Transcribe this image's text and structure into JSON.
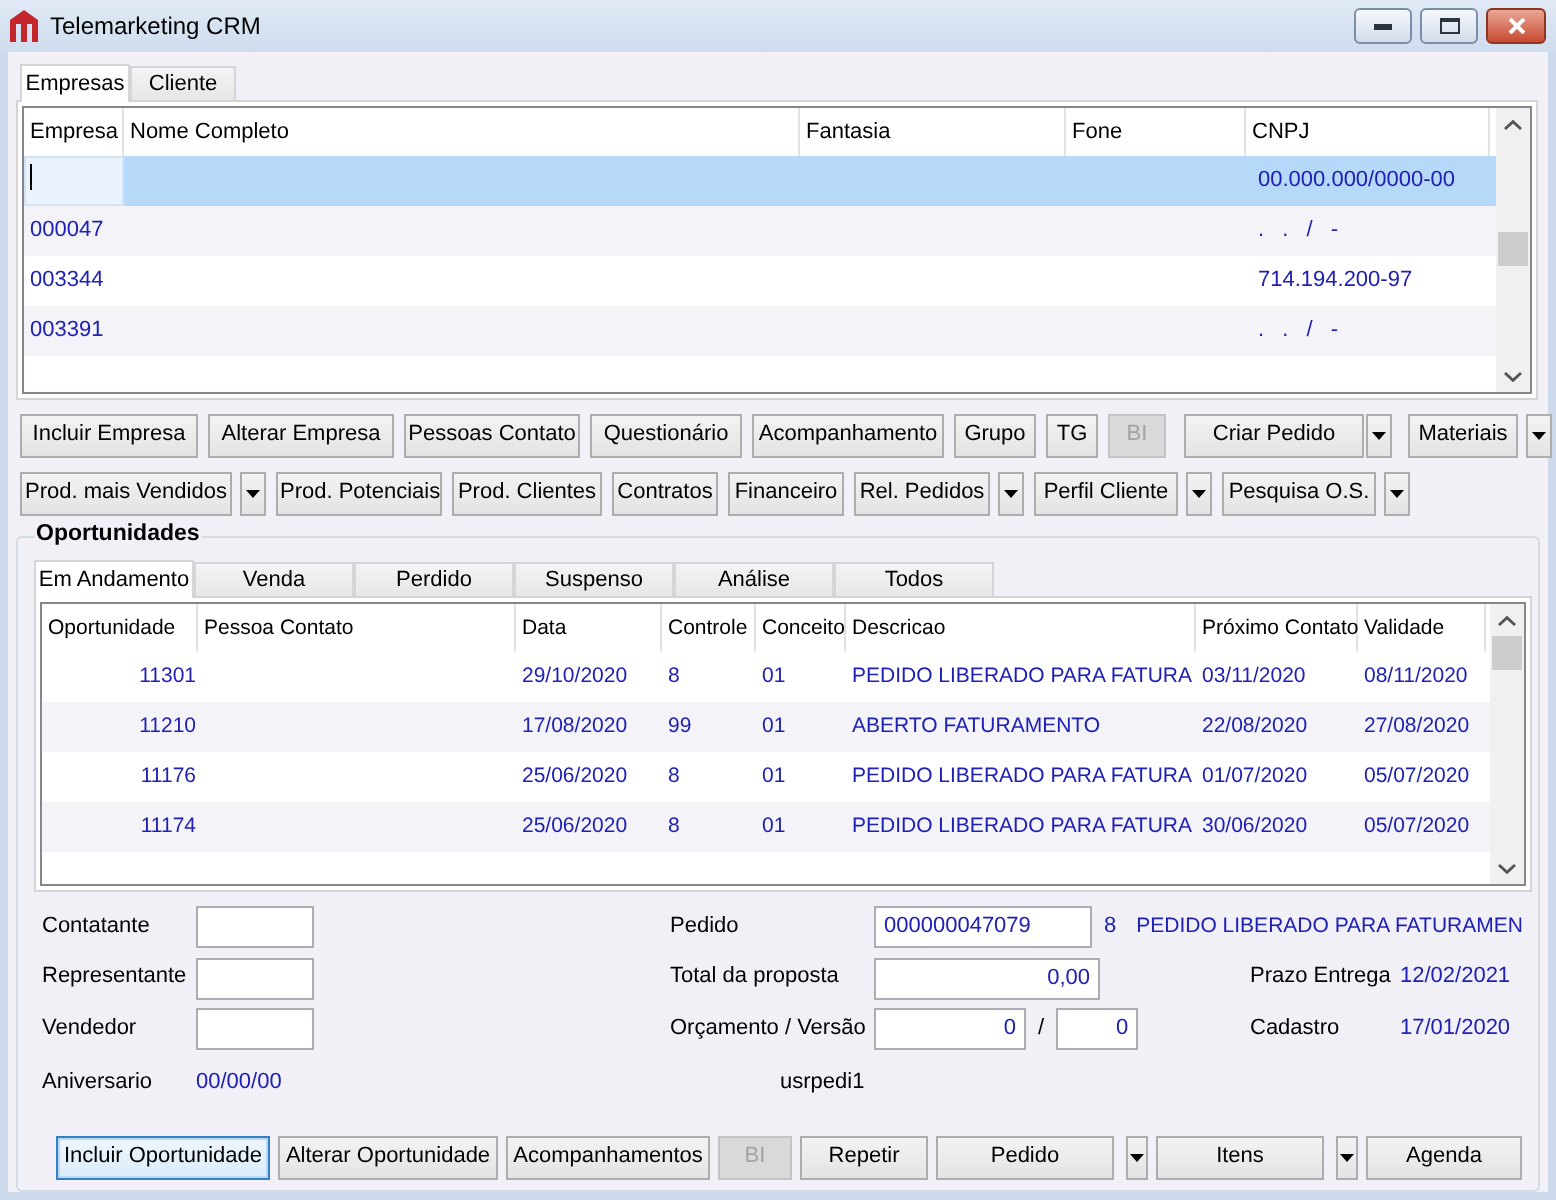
{
  "window": {
    "title": "Telemarketing CRM"
  },
  "company_tabs": [
    {
      "label": "Empresas",
      "selected": true
    },
    {
      "label": "Cliente",
      "selected": false
    }
  ],
  "companies_table": {
    "columns": [
      "Empresa",
      "Nome Completo",
      "Fantasia",
      "Fone",
      "CNPJ"
    ],
    "rows": [
      {
        "selected": true,
        "editing": true,
        "cnpj": "00.000.000/0000-00"
      },
      {
        "selected": false,
        "editing": false,
        "empresa": "000047",
        "cnpj": ". . / -"
      },
      {
        "selected": false,
        "editing": false,
        "empresa": "003344",
        "cnpj": "714.194.200-97"
      },
      {
        "selected": false,
        "editing": false,
        "empresa": "003391",
        "cnpj": ". . / -"
      }
    ]
  },
  "toolbar_rows": [
    [
      {
        "label": "Incluir Empresa",
        "disabled": false,
        "menu": false
      },
      {
        "label": "Alterar Empresa",
        "disabled": false,
        "menu": false
      },
      {
        "label": "Pessoas Contato",
        "disabled": false,
        "menu": false
      },
      {
        "label": "Questionário",
        "disabled": false,
        "menu": false
      },
      {
        "label": "Acompanhamento",
        "disabled": false,
        "menu": false
      },
      {
        "label": "Grupo",
        "disabled": false,
        "menu": false
      },
      {
        "label": "TG",
        "disabled": false,
        "menu": false
      },
      {
        "label": "BI",
        "disabled": true,
        "menu": false
      },
      {
        "label": "Criar Pedido",
        "disabled": false,
        "menu": true
      },
      {
        "label": "Materiais",
        "disabled": false,
        "menu": true
      }
    ],
    [
      {
        "label": "Prod. mais Vendidos",
        "disabled": false,
        "menu": true
      },
      {
        "label": "Prod. Potenciais",
        "disabled": false,
        "menu": false
      },
      {
        "label": "Prod. Clientes",
        "disabled": false,
        "menu": false
      },
      {
        "label": "Contratos",
        "disabled": false,
        "menu": false
      },
      {
        "label": "Financeiro",
        "disabled": false,
        "menu": false
      },
      {
        "label": "Rel. Pedidos",
        "disabled": false,
        "menu": true
      },
      {
        "label": "Perfil Cliente",
        "disabled": false,
        "menu": true
      },
      {
        "label": "Pesquisa O.S.",
        "disabled": false,
        "menu": true
      }
    ]
  ],
  "opportunities": {
    "title": "Oportunidades",
    "tabs": [
      {
        "label": "Em Andamento",
        "selected": true
      },
      {
        "label": "Venda",
        "selected": false
      },
      {
        "label": "Perdido",
        "selected": false
      },
      {
        "label": "Suspenso",
        "selected": false
      },
      {
        "label": "Análise",
        "selected": false
      },
      {
        "label": "Todos",
        "selected": false
      }
    ],
    "table": {
      "columns": [
        "Oportunidade",
        "Pessoa Contato",
        "Data",
        "Controle",
        "Conceito",
        "Descricao",
        "Próximo Contato",
        "Validade"
      ],
      "rows": [
        {
          "selected": false,
          "oportunidade": "11301",
          "data": "29/10/2020",
          "controle": "8",
          "conceito": "01",
          "descricao": "PEDIDO LIBERADO PARA FATURA",
          "proximo_contato": "03/11/2020",
          "validade": "08/11/2020"
        },
        {
          "selected": false,
          "oportunidade": "11210",
          "data": "17/08/2020",
          "controle": "99",
          "conceito": "01",
          "descricao": "ABERTO FATURAMENTO",
          "proximo_contato": "22/08/2020",
          "validade": "27/08/2020"
        },
        {
          "selected": false,
          "oportunidade": "11176",
          "data": "25/06/2020",
          "controle": "8",
          "conceito": "01",
          "descricao": "PEDIDO LIBERADO PARA FATURA",
          "proximo_contato": "01/07/2020",
          "validade": "05/07/2020"
        },
        {
          "selected": false,
          "oportunidade": "11174",
          "data": "25/06/2020",
          "controle": "8",
          "conceito": "01",
          "descricao": "PEDIDO LIBERADO PARA FATURA",
          "proximo_contato": "30/06/2020",
          "validade": "05/07/2020"
        }
      ]
    }
  },
  "form": {
    "people": [
      {
        "label": "Contatante",
        "kind": "field"
      },
      {
        "label": "Representante",
        "kind": "field"
      },
      {
        "label": "Vendedor",
        "kind": "field"
      },
      {
        "label": "Aniversario",
        "kind": "text",
        "value": "00/00/00"
      }
    ],
    "order": {
      "label": "Pedido",
      "value": "000000047079",
      "status_code": "8",
      "status": "PEDIDO LIBERADO PARA FATURAMEN"
    },
    "total": {
      "label": "Total da proposta",
      "value": "0,00"
    },
    "budget": {
      "label": "Orçamento / Versão",
      "budget": "0",
      "separator": "/",
      "version": "0"
    },
    "user": "usrpedi1",
    "dates": [
      {
        "label": "Prazo Entrega",
        "value": "12/02/2021"
      },
      {
        "label": "Cadastro",
        "value": "17/01/2020"
      }
    ]
  },
  "action_buttons": [
    {
      "label": "Incluir Oportunidade",
      "focused": true,
      "disabled": false,
      "menu": false
    },
    {
      "label": "Alterar Oportunidade",
      "focused": false,
      "disabled": false,
      "menu": false
    },
    {
      "label": "Acompanhamentos",
      "focused": false,
      "disabled": false,
      "menu": false
    },
    {
      "label": "BI",
      "focused": false,
      "disabled": true,
      "menu": false
    },
    {
      "label": "Repetir",
      "focused": false,
      "disabled": false,
      "menu": false
    },
    {
      "label": "Pedido",
      "focused": false,
      "disabled": false,
      "menu": true
    },
    {
      "label": "Itens",
      "focused": false,
      "disabled": false,
      "menu": true
    },
    {
      "label": "Agenda",
      "focused": false,
      "disabled": false,
      "menu": false
    }
  ]
}
